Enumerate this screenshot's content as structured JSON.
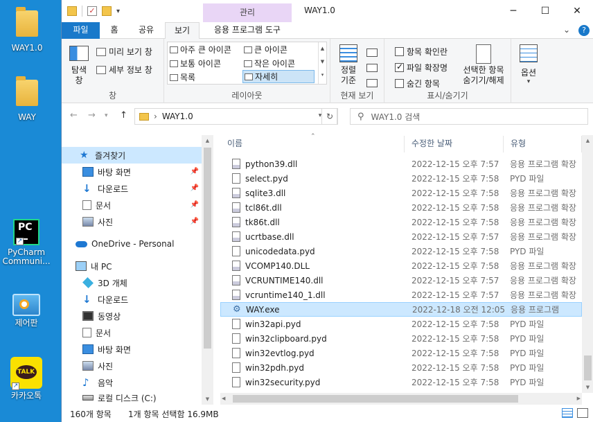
{
  "desktop": {
    "icons": [
      {
        "label": "WAY1.0",
        "icon": "folder-icon"
      },
      {
        "label": "WAY",
        "icon": "folder-icon"
      },
      {
        "label": "PyCharm Communi...",
        "icon": "pycharm-icon"
      },
      {
        "label": "제어판",
        "icon": "control-panel-icon"
      },
      {
        "label": "카카오톡",
        "icon": "kakaotalk-icon"
      }
    ],
    "pycharm_badge": "PC",
    "talk_badge": "TALK"
  },
  "window": {
    "title": "WAY1.0",
    "context_tab": "관리",
    "tabs": [
      "파일",
      "홈",
      "공유",
      "보기",
      "응용 프로그램 도구"
    ],
    "active_tab": "보기"
  },
  "ribbon": {
    "pane": {
      "nav_pane_label": "탐색 창",
      "preview_label": "미리 보기 창",
      "details_label": "세부 정보 창",
      "group_label": "창"
    },
    "layout": {
      "items": [
        "아주 큰 아이콘",
        "큰 아이콘",
        "보통 아이콘",
        "작은 아이콘",
        "목록",
        "자세히"
      ],
      "selected": "자세히",
      "group_label": "레이아웃"
    },
    "current_view": {
      "sort_label": "정렬 기준",
      "group_label": "현재 보기"
    },
    "show_hide": {
      "item_checkboxes": "항목 확인란",
      "item_checkboxes_checked": false,
      "extensions": "파일 확장명",
      "extensions_checked": true,
      "hidden_items": "숨긴 항목",
      "hidden_items_checked": false,
      "hide_selected": "선택한 항목 숨기기/해제",
      "group_label": "표시/숨기기"
    },
    "options_label": "옵션"
  },
  "address": {
    "path": "WAY1.0",
    "search_placeholder": "WAY1.0 검색"
  },
  "nav_pane": {
    "items": [
      {
        "label": "즐겨찾기",
        "icon": "star-icon",
        "pinned": false
      },
      {
        "label": "바탕 화면",
        "icon": "desktop-icon",
        "pinned": true
      },
      {
        "label": "다운로드",
        "icon": "download-icon",
        "pinned": true
      },
      {
        "label": "문서",
        "icon": "document-icon",
        "pinned": true
      },
      {
        "label": "사진",
        "icon": "pictures-icon",
        "pinned": true
      },
      {
        "label": "OneDrive - Personal",
        "icon": "onedrive-icon",
        "pinned": false
      },
      {
        "label": "내 PC",
        "icon": "pc-icon",
        "pinned": false
      },
      {
        "label": "3D 개체",
        "icon": "3d-objects-icon",
        "pinned": false
      },
      {
        "label": "다운로드",
        "icon": "download-icon",
        "pinned": false
      },
      {
        "label": "동영상",
        "icon": "video-icon",
        "pinned": false
      },
      {
        "label": "문서",
        "icon": "document-icon",
        "pinned": false
      },
      {
        "label": "바탕 화면",
        "icon": "desktop-icon",
        "pinned": false
      },
      {
        "label": "사진",
        "icon": "pictures-icon",
        "pinned": false
      },
      {
        "label": "음악",
        "icon": "music-icon",
        "pinned": false
      },
      {
        "label": "로컬 디스크 (C:)",
        "icon": "drive-icon",
        "pinned": false
      }
    ]
  },
  "file_list": {
    "columns": [
      "이름",
      "수정한 날짜",
      "유형"
    ],
    "rows": [
      {
        "name": "python39.dll",
        "date": "2022-12-15 오후 7:57",
        "type": "응용 프로그램 확장",
        "icon": "dll-file-icon"
      },
      {
        "name": "select.pyd",
        "date": "2022-12-15 오후 7:58",
        "type": "PYD 파일",
        "icon": "file-icon"
      },
      {
        "name": "sqlite3.dll",
        "date": "2022-12-15 오후 7:58",
        "type": "응용 프로그램 확장",
        "icon": "dll-file-icon"
      },
      {
        "name": "tcl86t.dll",
        "date": "2022-12-15 오후 7:58",
        "type": "응용 프로그램 확장",
        "icon": "dll-file-icon"
      },
      {
        "name": "tk86t.dll",
        "date": "2022-12-15 오후 7:58",
        "type": "응용 프로그램 확장",
        "icon": "dll-file-icon"
      },
      {
        "name": "ucrtbase.dll",
        "date": "2022-12-15 오후 7:57",
        "type": "응용 프로그램 확장",
        "icon": "dll-file-icon"
      },
      {
        "name": "unicodedata.pyd",
        "date": "2022-12-15 오후 7:58",
        "type": "PYD 파일",
        "icon": "file-icon"
      },
      {
        "name": "VCOMP140.DLL",
        "date": "2022-12-15 오후 7:58",
        "type": "응용 프로그램 확장",
        "icon": "dll-file-icon"
      },
      {
        "name": "VCRUNTIME140.dll",
        "date": "2022-12-15 오후 7:57",
        "type": "응용 프로그램 확장",
        "icon": "dll-file-icon"
      },
      {
        "name": "vcruntime140_1.dll",
        "date": "2022-12-15 오후 7:57",
        "type": "응용 프로그램 확장",
        "icon": "dll-file-icon"
      },
      {
        "name": "WAY.exe",
        "date": "2022-12-18 오전 12:05",
        "type": "응용 프로그램",
        "icon": "exe-icon",
        "selected": true
      },
      {
        "name": "win32api.pyd",
        "date": "2022-12-15 오후 7:58",
        "type": "PYD 파일",
        "icon": "file-icon"
      },
      {
        "name": "win32clipboard.pyd",
        "date": "2022-12-15 오후 7:58",
        "type": "PYD 파일",
        "icon": "file-icon"
      },
      {
        "name": "win32evtlog.pyd",
        "date": "2022-12-15 오후 7:58",
        "type": "PYD 파일",
        "icon": "file-icon"
      },
      {
        "name": "win32pdh.pyd",
        "date": "2022-12-15 오후 7:58",
        "type": "PYD 파일",
        "icon": "file-icon"
      },
      {
        "name": "win32security.pyd",
        "date": "2022-12-15 오후 7:58",
        "type": "PYD 파일",
        "icon": "file-icon"
      }
    ]
  },
  "status": {
    "count": "160개 항목",
    "selection": "1개 항목 선택함 16.9MB"
  },
  "colors": {
    "desktop": "#1a8ad6",
    "accent": "#1979ca",
    "context_tab": "#e9d6f6",
    "selection": "#cce8ff"
  }
}
